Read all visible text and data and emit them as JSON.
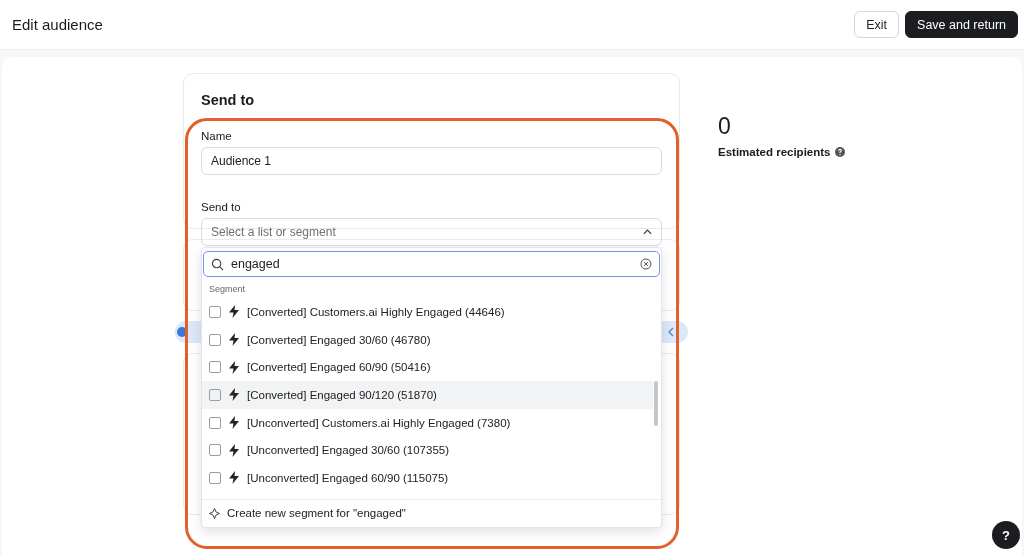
{
  "header": {
    "title": "Edit audience",
    "buttons": [
      {
        "label": "Exit",
        "kind": "secondary"
      },
      {
        "label": "Save and return",
        "kind": "primary"
      }
    ]
  },
  "card": {
    "title": "Send to",
    "name_field": {
      "label": "Name",
      "value": "Audience 1"
    },
    "send_to": {
      "label": "Send to",
      "placeholder": "Select a list or segment",
      "expanded": true
    }
  },
  "dropdown": {
    "search": {
      "value": "engaged"
    },
    "group": "Segment",
    "options": [
      {
        "label": "[Converted] Customers.ai Highly Engaged (44646)",
        "checked": false,
        "highlighted": false
      },
      {
        "label": "[Converted] Engaged 30/60 (46780)",
        "checked": false,
        "highlighted": false
      },
      {
        "label": "[Converted] Engaged 60/90 (50416)",
        "checked": false,
        "highlighted": false
      },
      {
        "label": "[Converted] Engaged 90/120 (51870)",
        "checked": false,
        "highlighted": true
      },
      {
        "label": "[Unconverted] Customers.ai Highly Engaged (7380)",
        "checked": false,
        "highlighted": false
      },
      {
        "label": "[Unconverted] Engaged 30/60 (107355)",
        "checked": false,
        "highlighted": false
      },
      {
        "label": "[Unconverted] Engaged 60/90 (115075)",
        "checked": false,
        "highlighted": false
      }
    ],
    "create": "Create new segment for \"engaged\""
  },
  "summary": {
    "count": "0",
    "label": "Estimated recipients"
  },
  "help": "?"
}
